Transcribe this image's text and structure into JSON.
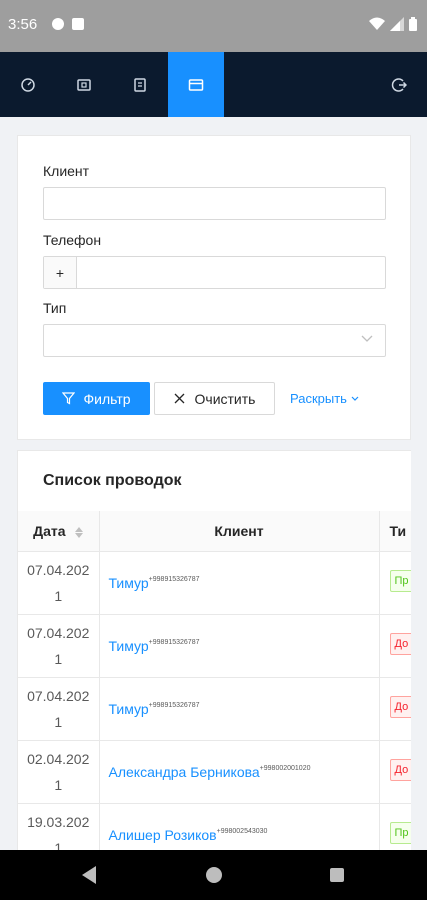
{
  "status_bar": {
    "time": "3:56"
  },
  "filter": {
    "client_label": "Клиент",
    "client_value": "",
    "phone_label": "Телефон",
    "phone_prefix": "+",
    "phone_value": "",
    "type_label": "Тип",
    "type_value": "",
    "filter_button": "Фильтр",
    "clear_button": "Очистить",
    "expand_link": "Раскрыть"
  },
  "list": {
    "title": "Список проводок",
    "columns": {
      "date": "Дата",
      "client": "Клиент",
      "type": "Ти"
    },
    "rows": [
      {
        "date": "07.04.2021",
        "client": "Тимур",
        "phone": "+998915326787",
        "type": "Пр",
        "type_color": "green"
      },
      {
        "date": "07.04.2021",
        "client": "Тимур",
        "phone": "+998915326787",
        "type": "До",
        "type_color": "red"
      },
      {
        "date": "07.04.2021",
        "client": "Тимур",
        "phone": "+998915326787",
        "type": "До",
        "type_color": "red"
      },
      {
        "date": "02.04.2021",
        "client": "Александра Берникова",
        "phone": "+998002001020",
        "type": "До",
        "type_color": "red"
      },
      {
        "date": "19.03.2021",
        "client": "Алишер Розиков",
        "phone": "+998002543030",
        "type": "Пр",
        "type_color": "green"
      }
    ]
  },
  "colors": {
    "primary": "#1890ff",
    "nav_bg": "#0b1a2e",
    "success": "#52c41a",
    "danger": "#f5222d"
  }
}
